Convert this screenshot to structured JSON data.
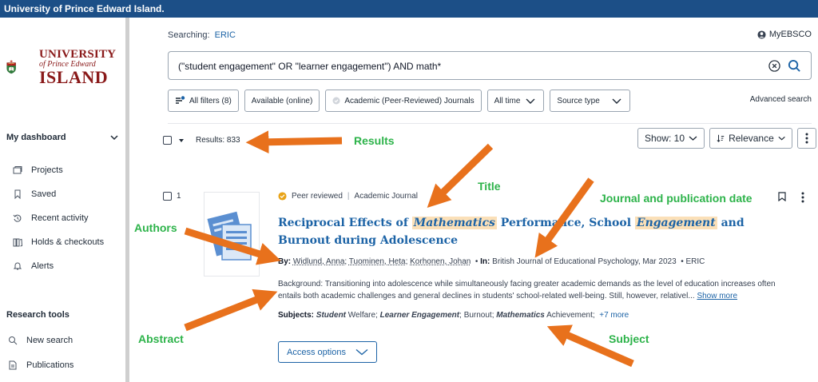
{
  "topbar": {
    "title": "University of Prince Edward Island."
  },
  "logo": {
    "line1": "UNIVERSITY",
    "line2": "of Prince Edward",
    "line3": "ISLAND"
  },
  "sidebar": {
    "dashboard_label": "My dashboard",
    "items": [
      {
        "label": "Projects",
        "icon": "folder-icon"
      },
      {
        "label": "Saved",
        "icon": "bookmark-icon"
      },
      {
        "label": "Recent activity",
        "icon": "history-icon"
      },
      {
        "label": "Holds & checkouts",
        "icon": "books-icon"
      },
      {
        "label": "Alerts",
        "icon": "bell-icon"
      }
    ],
    "research_tools_label": "Research tools",
    "tools": [
      {
        "label": "New search",
        "icon": "search-icon"
      },
      {
        "label": "Publications",
        "icon": "document-icon"
      }
    ]
  },
  "header": {
    "searching_label": "Searching:",
    "database": "ERIC",
    "account": "MyEBSCO"
  },
  "search": {
    "query": "(\"student engagement\" OR \"learner engagement\") AND math*"
  },
  "filters": {
    "all_filters": "All filters (8)",
    "available": "Available (online)",
    "peer_reviewed": "Academic (Peer-Reviewed) Journals",
    "time": "All time",
    "source_type": "Source type",
    "advanced": "Advanced search"
  },
  "results": {
    "label": "Results: 833",
    "show": "Show: 10",
    "sort": "Relevance"
  },
  "record": {
    "number": "1",
    "badge": "Peer reviewed",
    "type": "Academic Journal",
    "title_pre": "Reciprocal Effects of ",
    "title_hl1": "Mathematics",
    "title_mid": " Performance, School ",
    "title_hl2": "Engagement",
    "title_post": " and Burnout during Adolescence",
    "by_label": "By:",
    "authors": [
      "Widlund, Anna",
      "Tuominen, Heta",
      "Korhonen, Johan"
    ],
    "in_label": "In:",
    "source": "British Journal of Educational Psychology, Mar 2023",
    "database": "ERIC",
    "abstract": "Background: Transitioning into adolescence while simultaneously facing greater academic demands as the level of education increases often entails both academic challenges and general declines in students' school-related well-being. Still, however, relativel...",
    "show_more": "Show more",
    "subjects_label": "Subjects:",
    "subjects": [
      {
        "bold": "Student",
        "rest": " Welfare"
      },
      {
        "bold": "Learner Engagement",
        "rest": ""
      },
      {
        "bold": "",
        "rest": "Burnout"
      },
      {
        "bold": "Mathematics",
        "rest": " Achievement"
      }
    ],
    "more_subjects": "+7 more",
    "access_options": "Access options"
  },
  "annotations": {
    "results": "Results",
    "title": "Title",
    "journal": "Journal and publication date",
    "authors": "Authors",
    "abstract": "Abstract",
    "subject": "Subject"
  },
  "colors": {
    "topbar": "#1c4f87",
    "link": "#1c63a6",
    "annotation": "#2db34a",
    "arrow": "#e8711c",
    "highlight": "#fbe0b8"
  }
}
